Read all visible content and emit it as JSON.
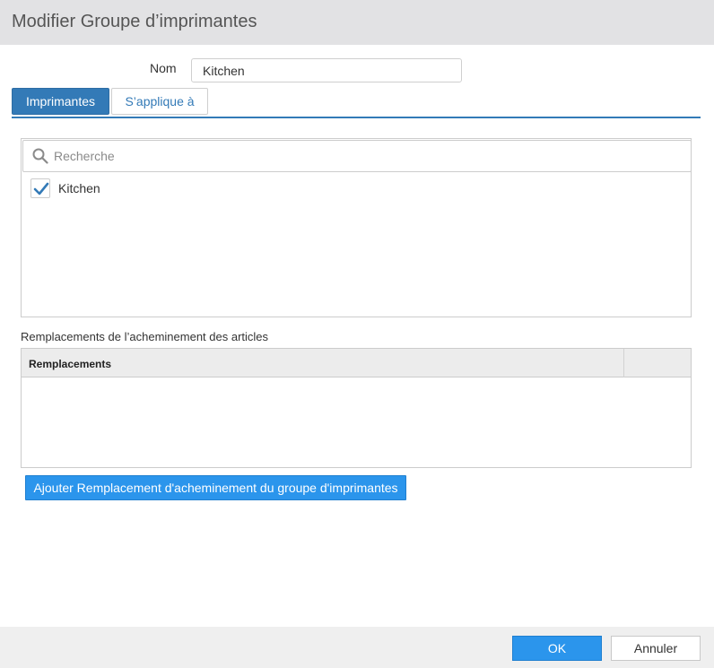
{
  "dialog": {
    "title": "Modifier Groupe d’imprimantes"
  },
  "name_field": {
    "label": "Nom",
    "value": "Kitchen"
  },
  "tabs": [
    {
      "label": "Imprimantes",
      "active": true
    },
    {
      "label": "S’applique à",
      "active": false
    }
  ],
  "printer_list": {
    "search_placeholder": "Recherche",
    "items": [
      {
        "label": "Kitchen",
        "checked": true
      }
    ]
  },
  "overrides": {
    "section_label": "Remplacements de l’acheminement des articles",
    "column_header": "Remplacements",
    "rows": []
  },
  "add_override_button": "Ajouter Remplacement d'acheminement du groupe d'imprimantes",
  "footer": {
    "ok_label": "OK",
    "cancel_label": "Annuler"
  },
  "colors": {
    "accent": "#337ab7",
    "button_primary": "#2b95ec",
    "title_bar": "#e2e2e4",
    "footer": "#efefef"
  },
  "icons": {
    "search": "search-icon",
    "checkmark": "checkmark-icon"
  }
}
